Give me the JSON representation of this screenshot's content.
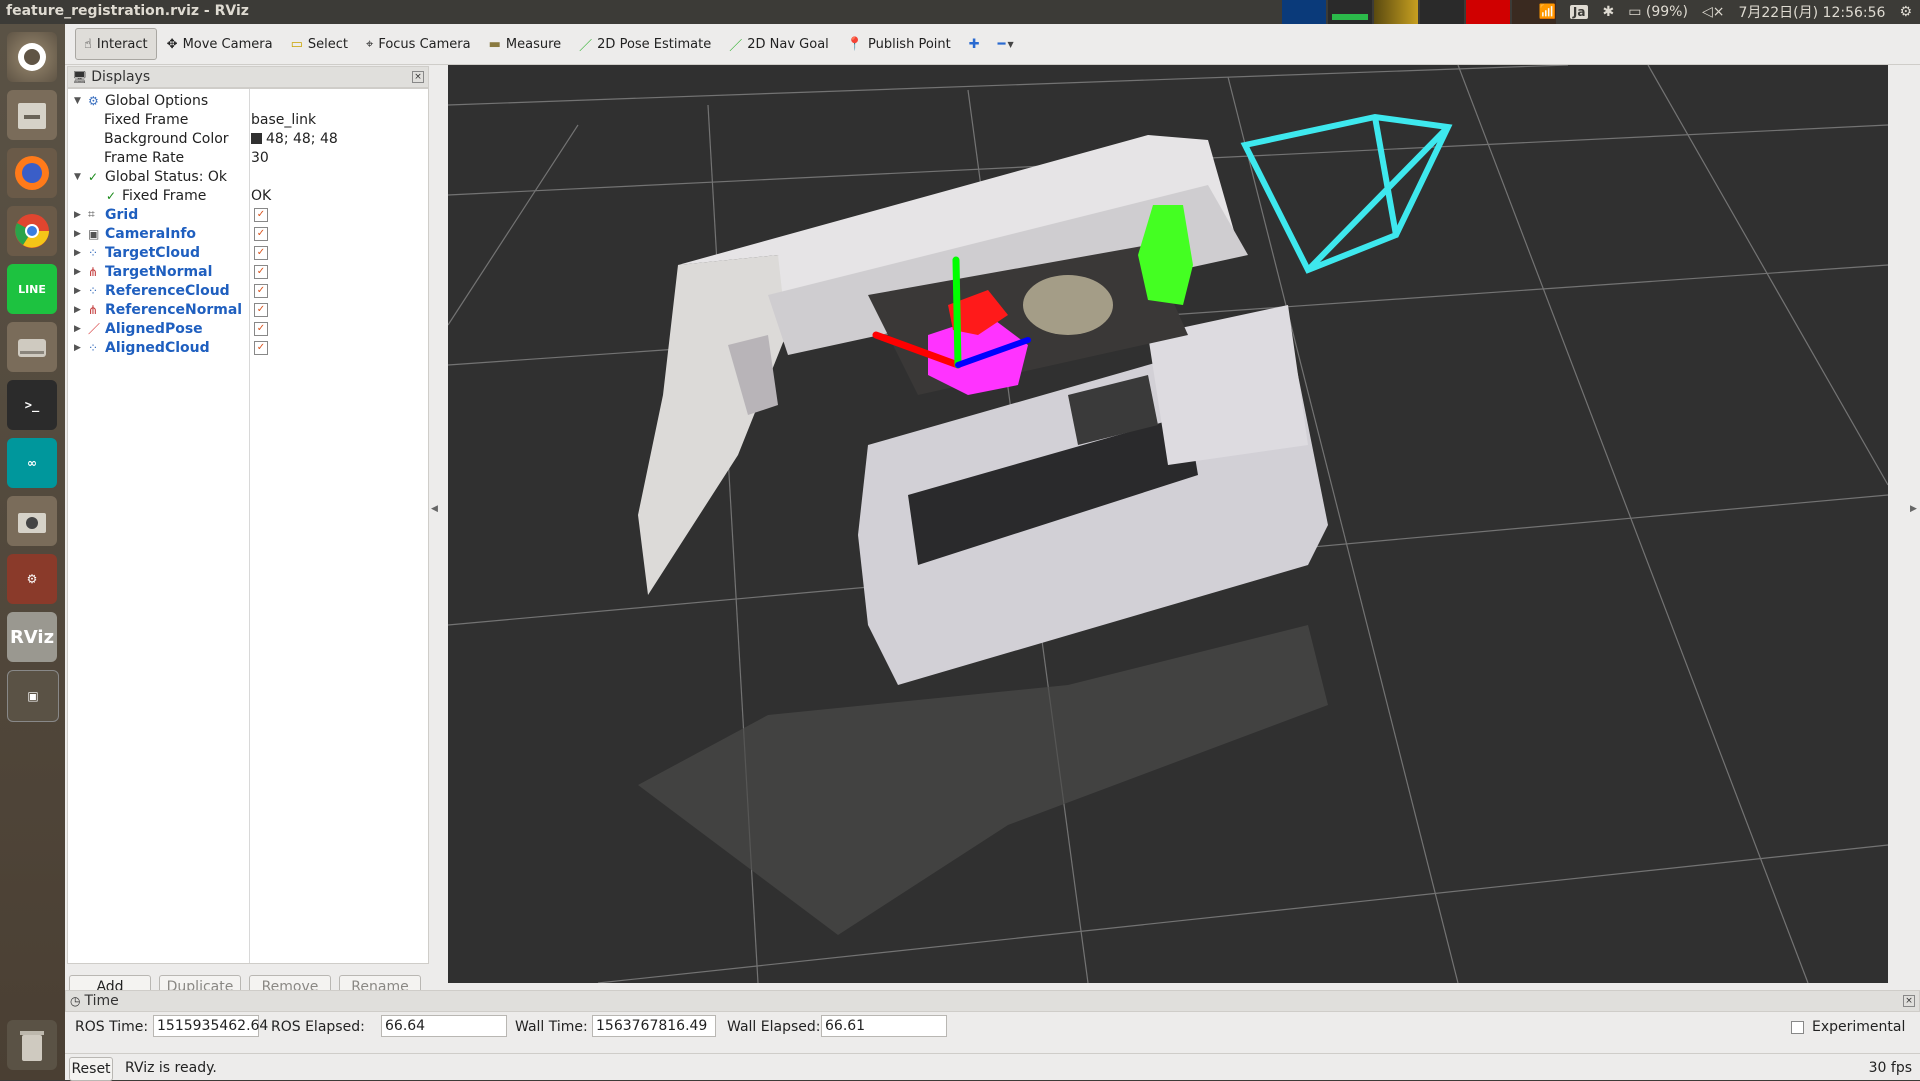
{
  "window": {
    "title": "feature_registration.rviz - RViz"
  },
  "tray": {
    "lang": "Ja",
    "battery": "(99%)",
    "clock": "7月22日(月) 12:56:56"
  },
  "launcher": {
    "items": [
      "dash-home",
      "files",
      "firefox",
      "chrome",
      "line",
      "disk",
      "terminal",
      "arduino",
      "screenshot",
      "system-settings",
      "rviz",
      "workspaces",
      "trash"
    ],
    "rviz_label": "RViz"
  },
  "toolbar": {
    "tools": [
      {
        "label": "Interact",
        "icon": "hand-icon"
      },
      {
        "label": "Move Camera",
        "icon": "move-icon"
      },
      {
        "label": "Select",
        "icon": "select-icon"
      },
      {
        "label": "Focus Camera",
        "icon": "focus-icon"
      },
      {
        "label": "Measure",
        "icon": "ruler-icon"
      },
      {
        "label": "2D Pose Estimate",
        "icon": "green-arrow-icon"
      },
      {
        "label": "2D Nav Goal",
        "icon": "green-arrow-icon"
      },
      {
        "label": "Publish Point",
        "icon": "pin-icon"
      }
    ]
  },
  "displays": {
    "title": "Displays",
    "global_options": "Global Options",
    "fixed_frame_label": "Fixed Frame",
    "fixed_frame_value": "base_link",
    "bg_color_label": "Background Color",
    "bg_color_value": "48; 48; 48",
    "frame_rate_label": "Frame Rate",
    "frame_rate_value": "30",
    "global_status": "Global Status: Ok",
    "status_fixed_frame": "Fixed Frame",
    "status_fixed_frame_value": "OK",
    "items": [
      "Grid",
      "CameraInfo",
      "TargetCloud",
      "TargetNormal",
      "ReferenceCloud",
      "ReferenceNormal",
      "AlignedPose",
      "AlignedCloud"
    ],
    "buttons": {
      "add": "Add",
      "duplicate": "Duplicate",
      "remove": "Remove",
      "rename": "Rename"
    }
  },
  "time": {
    "title": "Time",
    "ros_time_label": "ROS Time:",
    "ros_time": "1515935462.64",
    "ros_elapsed_label": "ROS Elapsed:",
    "ros_elapsed": "66.64",
    "wall_time_label": "Wall Time:",
    "wall_time": "1563767816.49",
    "wall_elapsed_label": "Wall Elapsed:",
    "wall_elapsed": "66.61",
    "experimental": "Experimental"
  },
  "status": {
    "reset": "Reset",
    "message": "RViz is ready.",
    "fps": "30 fps"
  },
  "colors": {
    "viewport_bg": "#303030",
    "camera_frustum": "#3ee8ee",
    "axis_x": "#ff0000",
    "axis_y": "#00ff00",
    "axis_z": "#0000ff",
    "aligned_cloud": "#ff33ff",
    "target_cloud": "#44ff22"
  }
}
